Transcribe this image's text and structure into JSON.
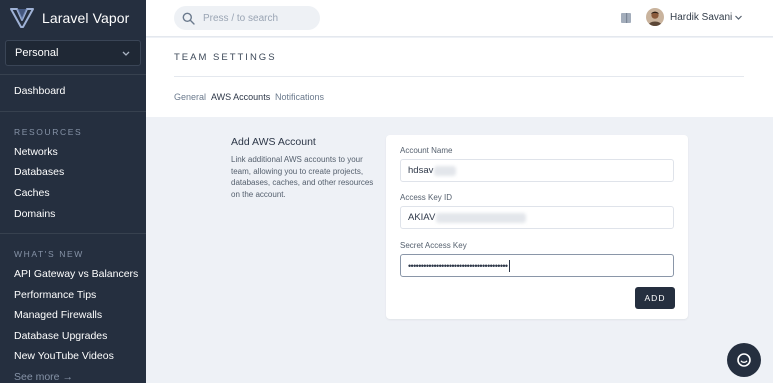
{
  "app": {
    "name": "Laravel Vapor"
  },
  "sidebar": {
    "team": "Personal",
    "dashboard": "Dashboard",
    "resources_title": "RESOURCES",
    "resources": [
      "Networks",
      "Databases",
      "Caches",
      "Domains"
    ],
    "whats_new_title": "WHAT'S NEW",
    "whats_new": [
      "API Gateway vs Balancers",
      "Performance Tips",
      "Managed Firewalls",
      "Database Upgrades",
      "New YouTube Videos"
    ],
    "see_more": "See more →"
  },
  "topbar": {
    "search_placeholder": "Press / to search",
    "user_name": "Hardik Savani"
  },
  "settings": {
    "title": "TEAM SETTINGS",
    "tabs": [
      "General",
      "AWS Accounts",
      "Notifications"
    ],
    "active_tab": "AWS Accounts"
  },
  "add_account": {
    "heading": "Add AWS Account",
    "description": "Link additional AWS accounts to your team, allowing you to create projects, databases, caches, and other resources on the account.",
    "account_name_label": "Account Name",
    "account_name_value": "hdsav",
    "access_key_label": "Access Key ID",
    "access_key_value": "AKIAV",
    "secret_key_label": "Secret Access Key",
    "secret_key_value": "•••••••••••••••••••••••••••••••••••••••",
    "add_button": "ADD"
  },
  "colors": {
    "sidebar": "#252f3f",
    "background": "#eef1f6",
    "accent": "#252f3f"
  }
}
